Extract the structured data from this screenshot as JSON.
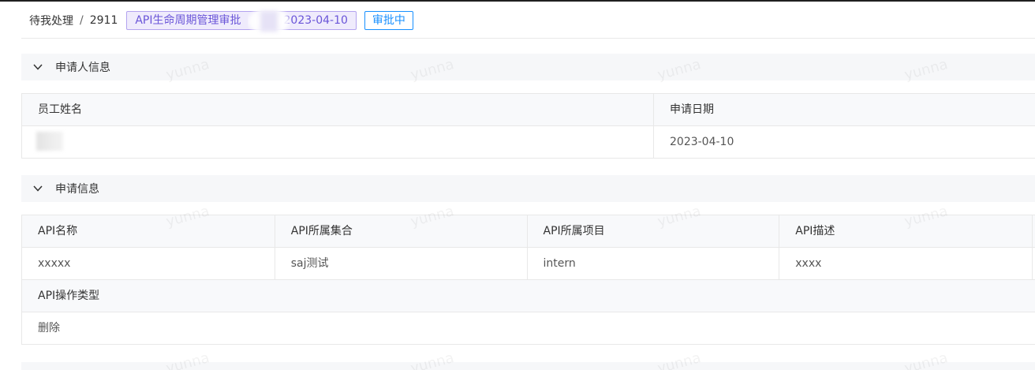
{
  "breadcrumb": {
    "root": "待我处理",
    "separator": "/",
    "id": "2911"
  },
  "title_tag": {
    "prefix": "API生命周期管理审批",
    "date": "2023-04-10"
  },
  "status_tag": "审批中",
  "applicant_section": {
    "title": "申请人信息",
    "headers": [
      "员工姓名",
      "申请日期"
    ],
    "values": [
      "",
      "2023-04-10"
    ]
  },
  "apply_section": {
    "title": "申请信息",
    "headers": [
      "API名称",
      "API所属集合",
      "API所属项目",
      "API描述"
    ],
    "values": [
      "xxxxx",
      "saj测试",
      "intern",
      "xxxx"
    ],
    "operation_header": "API操作类型",
    "operation_value": "删除"
  },
  "watermark": "yunna",
  "colors": {
    "title_tag_text": "#6a55d8",
    "title_tag_bg": "#efebfc",
    "status_tag": "#1890ff",
    "section_bg": "#f6f7f9"
  },
  "icons": [
    "chevron-down-icon"
  ]
}
